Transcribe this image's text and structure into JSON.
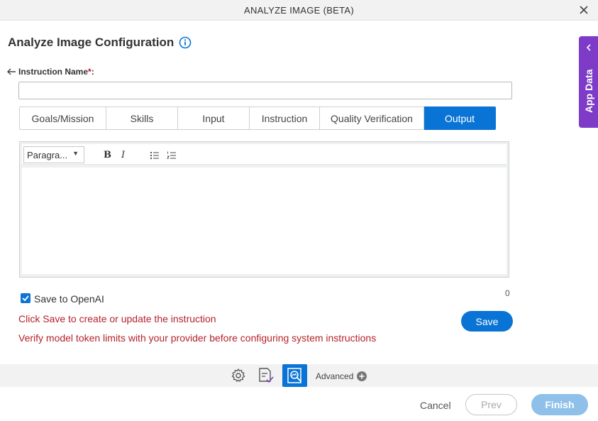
{
  "window": {
    "title": "ANALYZE IMAGE (BETA)",
    "close_icon": "close-icon"
  },
  "header": {
    "title": "Analyze Image Configuration",
    "info_icon": "info-icon"
  },
  "instruction_name": {
    "label": "Instruction Name",
    "required_mark": "*",
    "suffix": ":",
    "value": "",
    "back_icon": "arrow-left-icon"
  },
  "tabs": [
    {
      "label": "Goals/Mission",
      "active": false
    },
    {
      "label": "Skills",
      "active": false
    },
    {
      "label": "Input",
      "active": false
    },
    {
      "label": "Instruction",
      "active": false
    },
    {
      "label": "Quality Verification",
      "active": false
    },
    {
      "label": "Output",
      "active": true
    }
  ],
  "editor": {
    "format_select": "Paragra...",
    "bold": "B",
    "italic": "I",
    "content": ""
  },
  "save_to_openai": {
    "label": "Save to OpenAI",
    "checked": true
  },
  "char_counter": "0",
  "messages": [
    "Click Save to create or update the instruction",
    "Verify model token limits with your provider before configuring system instructions"
  ],
  "save_label": "Save",
  "bottom_bar": {
    "advanced_label": "Advanced",
    "icons": [
      "gear-icon",
      "document-check-icon",
      "image-search-icon"
    ]
  },
  "footer": {
    "cancel": "Cancel",
    "prev": "Prev",
    "finish": "Finish"
  },
  "app_data": {
    "label": "App Data"
  },
  "colors": {
    "accent": "#0a74d6",
    "app_data": "#7d3bc7",
    "error_text": "#b4232a"
  }
}
